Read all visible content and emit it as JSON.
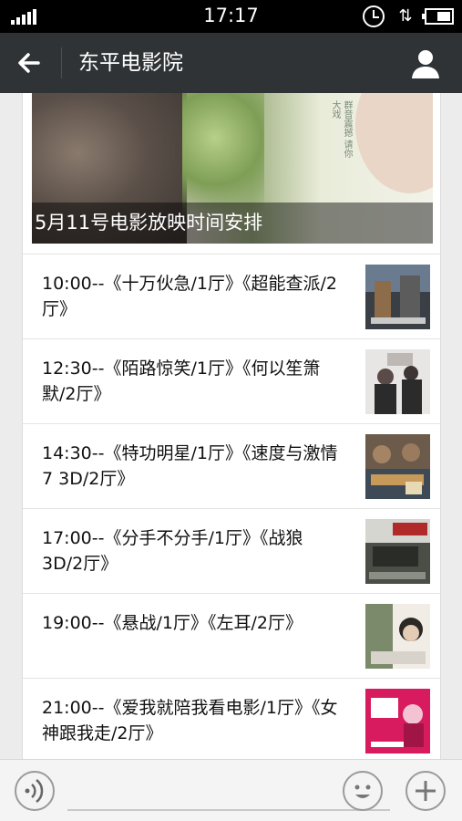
{
  "status_bar": {
    "time": "17:17"
  },
  "nav": {
    "title": "东平电影院"
  },
  "banner": {
    "caption": "5月11号电影放映时间安排",
    "poster_text": "群音震撼 请你大戏"
  },
  "schedule": [
    {
      "text": "10:00--《十万伙急/1厅》《超能查派/2厅》",
      "thumb_colors": [
        "#3a3f45",
        "#6a7b8f",
        "#8d6c4a"
      ]
    },
    {
      "text": "12:30--《陌路惊笑/1厅》《何以笙箫默/2厅》",
      "thumb_colors": [
        "#e8e6e4",
        "#2b2b2b",
        "#5a4a48"
      ]
    },
    {
      "text": "14:30--《特功明星/1厅》《速度与激情7 3D/2厅》",
      "thumb_colors": [
        "#6c5a4a",
        "#3e4a55",
        "#c79a5a"
      ]
    },
    {
      "text": "17:00--《分手不分手/1厅》《战狼3D/2厅》",
      "thumb_colors": [
        "#4a4e46",
        "#2a2c28",
        "#b02a2a"
      ]
    },
    {
      "text": "19:00--《悬战/1厅》《左耳/2厅》",
      "thumb_colors": [
        "#f1ede6",
        "#2b2826",
        "#7b8a6a"
      ]
    },
    {
      "text": "21:00--《爱我就陪我看电影/1厅》《女神跟我走/2厅》",
      "thumb_colors": [
        "#d81b5e",
        "#f4c3d3",
        "#ffffff"
      ]
    }
  ],
  "colors": {
    "nav_bg": "#2f3336",
    "page_bg": "#ececec",
    "card_bg": "#ffffff"
  },
  "icons": {
    "back": "back-arrow-icon",
    "profile": "person-icon",
    "voice": "voice-icon",
    "emoji": "emoji-icon",
    "plus": "plus-icon"
  }
}
